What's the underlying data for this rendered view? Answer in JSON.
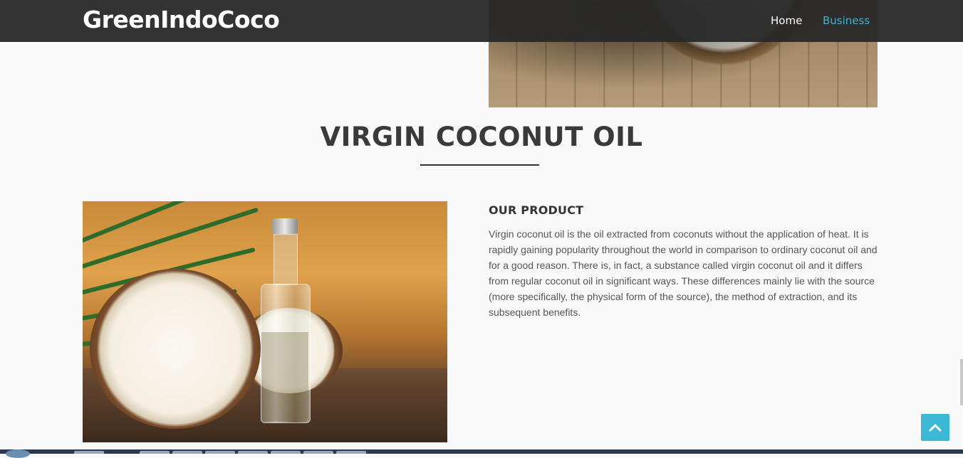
{
  "navbar": {
    "brand": "GreenIndoCoco",
    "links": [
      {
        "label": "Home",
        "active": false
      },
      {
        "label": "Business",
        "active": true
      }
    ]
  },
  "section": {
    "title": "VIRGIN COCONUT OIL"
  },
  "product": {
    "heading": "OUR PRODUCT",
    "description": "Virgin coconut oil is the oil extracted from coconuts without the application of heat. It is rapidly gaining popularity throughout the world in comparison to ordinary coconut oil and for a good reason. There is, in fact, a substance called virgin coconut oil and it differs from regular coconut oil in significant ways. These differences mainly lie with the source (more specifically, the physical form of the source), the method of extraction, and its subsequent benefits."
  },
  "scroll_top": {
    "icon": "chevron-up-icon"
  },
  "colors": {
    "accent": "#3fb5d0",
    "navbar_bg": "#282828",
    "page_bg": "#f9f9f9"
  }
}
